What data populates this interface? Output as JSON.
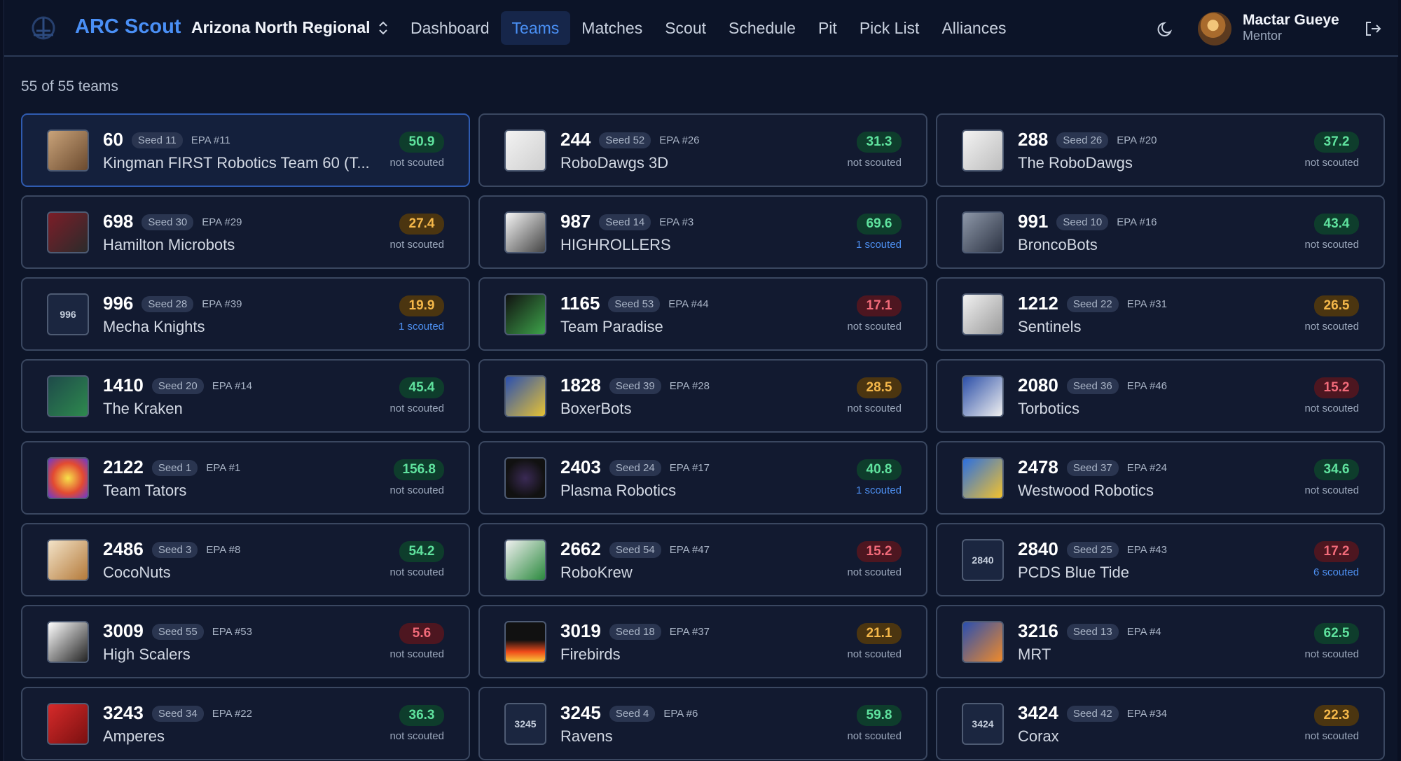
{
  "header": {
    "app_name": "ARC Scout",
    "event": "Arizona North Regional",
    "nav": [
      {
        "label": "Dashboard"
      },
      {
        "label": "Teams",
        "active": true
      },
      {
        "label": "Matches"
      },
      {
        "label": "Scout"
      },
      {
        "label": "Schedule"
      },
      {
        "label": "Pit"
      },
      {
        "label": "Pick List"
      },
      {
        "label": "Alliances"
      }
    ],
    "user": {
      "name": "Mactar Gueye",
      "role": "Mentor"
    },
    "icons": {
      "theme": "moon-icon",
      "logout": "logout-icon",
      "select": "chevron-up-down-icon"
    }
  },
  "summary": "55 of 55 teams",
  "colors": {
    "accent": "#4a8ff5",
    "green": "#5fe29e",
    "amber": "#f5b84a",
    "red": "#f26b7a"
  },
  "teams": [
    {
      "number": "60",
      "seed": "Seed 11",
      "epa_rank": "EPA #11",
      "name": "Kingman FIRST Robotics Team 60 (T...",
      "epa": "50.9",
      "level": "green",
      "scouted": "not scouted"
    },
    {
      "number": "244",
      "seed": "Seed 52",
      "epa_rank": "EPA #26",
      "name": "RoboDawgs 3D",
      "epa": "31.3",
      "level": "green",
      "scouted": "not scouted"
    },
    {
      "number": "288",
      "seed": "Seed 26",
      "epa_rank": "EPA #20",
      "name": "The RoboDawgs",
      "epa": "37.2",
      "level": "green",
      "scouted": "not scouted"
    },
    {
      "number": "698",
      "seed": "Seed 30",
      "epa_rank": "EPA #29",
      "name": "Hamilton Microbots",
      "epa": "27.4",
      "level": "amber",
      "scouted": "not scouted"
    },
    {
      "number": "987",
      "seed": "Seed 14",
      "epa_rank": "EPA #3",
      "name": "HIGHROLLERS",
      "epa": "69.6",
      "level": "green",
      "scouted": "1 scouted"
    },
    {
      "number": "991",
      "seed": "Seed 10",
      "epa_rank": "EPA #16",
      "name": "BroncoBots",
      "epa": "43.4",
      "level": "green",
      "scouted": "not scouted"
    },
    {
      "number": "996",
      "seed": "Seed 28",
      "epa_rank": "EPA #39",
      "name": "Mecha Knights",
      "epa": "19.9",
      "level": "amber",
      "scouted": "1 scouted",
      "thumb_text": "996"
    },
    {
      "number": "1165",
      "seed": "Seed 53",
      "epa_rank": "EPA #44",
      "name": "Team Paradise",
      "epa": "17.1",
      "level": "red",
      "scouted": "not scouted"
    },
    {
      "number": "1212",
      "seed": "Seed 22",
      "epa_rank": "EPA #31",
      "name": "Sentinels",
      "epa": "26.5",
      "level": "amber",
      "scouted": "not scouted"
    },
    {
      "number": "1410",
      "seed": "Seed 20",
      "epa_rank": "EPA #14",
      "name": "The Kraken",
      "epa": "45.4",
      "level": "green",
      "scouted": "not scouted"
    },
    {
      "number": "1828",
      "seed": "Seed 39",
      "epa_rank": "EPA #28",
      "name": "BoxerBots",
      "epa": "28.5",
      "level": "amber",
      "scouted": "not scouted"
    },
    {
      "number": "2080",
      "seed": "Seed 36",
      "epa_rank": "EPA #46",
      "name": "Torbotics",
      "epa": "15.2",
      "level": "red",
      "scouted": "not scouted"
    },
    {
      "number": "2122",
      "seed": "Seed 1",
      "epa_rank": "EPA #1",
      "name": "Team Tators",
      "epa": "156.8",
      "level": "green",
      "scouted": "not scouted"
    },
    {
      "number": "2403",
      "seed": "Seed 24",
      "epa_rank": "EPA #17",
      "name": "Plasma Robotics",
      "epa": "40.8",
      "level": "green",
      "scouted": "1 scouted"
    },
    {
      "number": "2478",
      "seed": "Seed 37",
      "epa_rank": "EPA #24",
      "name": "Westwood Robotics",
      "epa": "34.6",
      "level": "green",
      "scouted": "not scouted"
    },
    {
      "number": "2486",
      "seed": "Seed 3",
      "epa_rank": "EPA #8",
      "name": "CocoNuts",
      "epa": "54.2",
      "level": "green",
      "scouted": "not scouted"
    },
    {
      "number": "2662",
      "seed": "Seed 54",
      "epa_rank": "EPA #47",
      "name": "RoboKrew",
      "epa": "15.2",
      "level": "red",
      "scouted": "not scouted"
    },
    {
      "number": "2840",
      "seed": "Seed 25",
      "epa_rank": "EPA #43",
      "name": "PCDS Blue Tide",
      "epa": "17.2",
      "level": "red",
      "scouted": "6 scouted",
      "thumb_text": "2840"
    },
    {
      "number": "3009",
      "seed": "Seed 55",
      "epa_rank": "EPA #53",
      "name": "High Scalers",
      "epa": "5.6",
      "level": "red",
      "scouted": "not scouted"
    },
    {
      "number": "3019",
      "seed": "Seed 18",
      "epa_rank": "EPA #37",
      "name": "Firebirds",
      "epa": "21.1",
      "level": "amber",
      "scouted": "not scouted"
    },
    {
      "number": "3216",
      "seed": "Seed 13",
      "epa_rank": "EPA #4",
      "name": "MRT",
      "epa": "62.5",
      "level": "green",
      "scouted": "not scouted"
    },
    {
      "number": "3243",
      "seed": "Seed 34",
      "epa_rank": "EPA #22",
      "name": "Amperes",
      "epa": "36.3",
      "level": "green",
      "scouted": "not scouted"
    },
    {
      "number": "3245",
      "seed": "Seed 4",
      "epa_rank": "EPA #6",
      "name": "Ravens",
      "epa": "59.8",
      "level": "green",
      "scouted": "not scouted",
      "thumb_text": "3245"
    },
    {
      "number": "3424",
      "seed": "Seed 42",
      "epa_rank": "EPA #34",
      "name": "Corax",
      "epa": "22.3",
      "level": "amber",
      "scouted": "not scouted",
      "thumb_text": "3424"
    }
  ]
}
